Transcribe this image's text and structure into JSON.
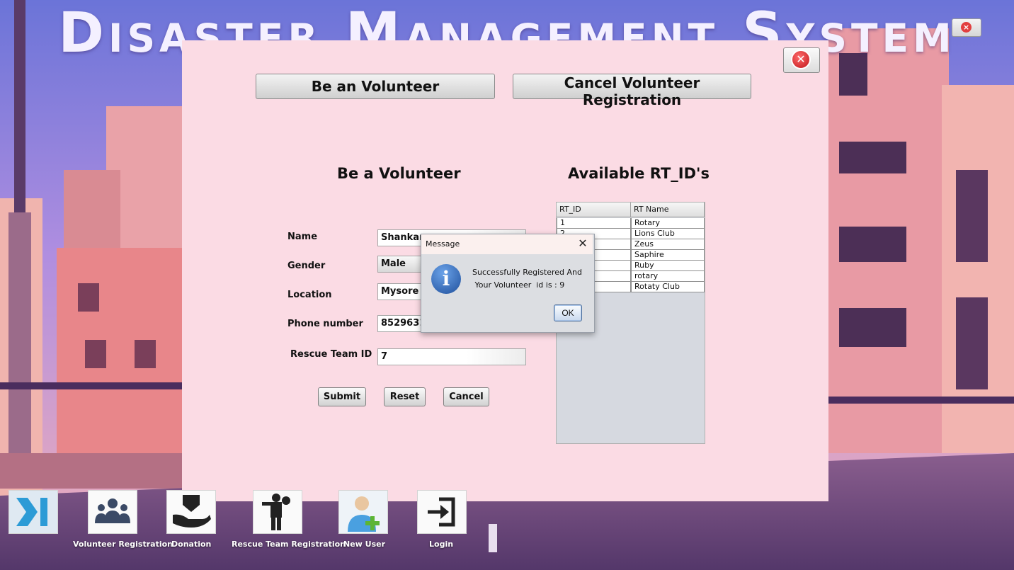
{
  "app": {
    "title": "Disaster Management System"
  },
  "top_buttons": {
    "be_volunteer": "Be an Volunteer",
    "cancel_registration": "Cancel Volunteer Registration"
  },
  "form": {
    "heading": "Be a Volunteer",
    "labels": {
      "name": "Name",
      "gender": "Gender",
      "location": "Location",
      "phone": "Phone number",
      "rescue_team_id": "Rescue Team ID"
    },
    "values": {
      "name": "Shankar",
      "gender": "Male",
      "location": "Mysore",
      "phone": "85296314",
      "rescue_team_id": "7"
    },
    "buttons": {
      "submit": "Submit",
      "reset": "Reset",
      "cancel": "Cancel"
    }
  },
  "rt_table": {
    "heading": "Available RT_ID's",
    "columns": [
      "RT_ID",
      "RT Name"
    ],
    "rows": [
      [
        "1",
        "Rotary"
      ],
      [
        "2",
        "Lions Club"
      ],
      [
        "",
        "Zeus"
      ],
      [
        "",
        "Saphire"
      ],
      [
        "",
        "Ruby"
      ],
      [
        "",
        "rotary"
      ],
      [
        "",
        "Rotaty Club"
      ]
    ]
  },
  "dialog": {
    "title": "Message",
    "line1": "Successfully Registered And",
    "line2": " Your Volunteer  id is : 9",
    "ok": "OK"
  },
  "nav": {
    "items": [
      {
        "label": "",
        "icon": "next-arrow-icon"
      },
      {
        "label": "Volunteer Registration",
        "icon": "group-icon"
      },
      {
        "label": "Donation",
        "icon": "donation-hand-icon"
      },
      {
        "label": "Rescue Team Registration",
        "icon": "rescuer-icon"
      },
      {
        "label": "New User",
        "icon": "add-user-icon"
      },
      {
        "label": "Login",
        "icon": "login-icon"
      }
    ]
  },
  "colors": {
    "panel_bg": "#fbdbe4",
    "dialog_bg": "#dcdee2",
    "info_icon": "#1f4f9c"
  }
}
